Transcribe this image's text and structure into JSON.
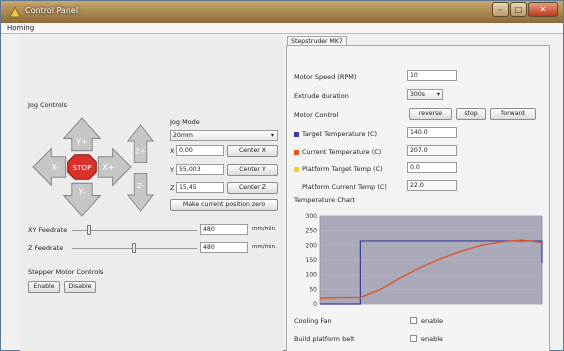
{
  "window": {
    "title": "Control Panel"
  },
  "menu": {
    "homing_tab": "Homing"
  },
  "jog": {
    "section_label": "Jog Controls",
    "y_plus": "Y+",
    "y_minus": "Y-",
    "x_plus": "X+",
    "x_minus": "X-",
    "z_plus": "Z+",
    "z_minus": "Z-",
    "stop": "STOP",
    "mode_label": "Jog Mode",
    "mode_value": "20mm",
    "x_label": "X",
    "x_value": "0,00",
    "y_label": "Y",
    "y_value": "55,003",
    "z_label": "Z",
    "z_value": "15,45",
    "center_x": "Center X",
    "center_y": "Center Y",
    "center_z": "Center Z",
    "make_zero": "Make current position zero"
  },
  "feedrate": {
    "xy_label": "XY Feedrate",
    "xy_value": "480",
    "xy_unit": "mm/min.",
    "z_label": "Z Feedrate",
    "z_value": "480",
    "z_unit": "mm/min."
  },
  "stepper": {
    "section_label": "Stepper Motor Controls",
    "enable": "Enable",
    "disable": "Disable"
  },
  "extruder": {
    "tab_label": "Stepstruder MK7",
    "motor_speed_label": "Motor Speed (RPM)",
    "motor_speed_value": "10",
    "extrude_duration_label": "Extrude duration",
    "extrude_duration_value": "300s",
    "motor_control_label": "Motor Control",
    "reverse": "reverse",
    "stop": "stop",
    "forward": "forward",
    "target_temp_label": "Target Temperature (C)",
    "target_temp_value": "140.0",
    "current_temp_label": "Current Temperature (C)",
    "current_temp_value": "207.0",
    "platform_target_label": "Platform Target Temp (C)",
    "platform_target_value": "0.0",
    "platform_current_label": "Platform Current Temp (C)",
    "platform_current_value": "22.0",
    "chart_label": "Temperature Chart",
    "cooling_fan_label": "Cooling Fan",
    "cooling_fan_check": "enable",
    "build_platform_label": "Build platform belt",
    "build_platform_check": "enable"
  },
  "colors": {
    "target_temp": "#3b3b9e",
    "current_temp": "#e0562a",
    "platform_target": "#f0d030"
  },
  "chart_data": {
    "type": "line",
    "y_ticks": [
      "300",
      "250",
      "200",
      "150",
      "100",
      "50",
      "0"
    ],
    "ylim": [
      0,
      300
    ],
    "series": [
      {
        "values": [
          0,
          0,
          215,
          215,
          215,
          215,
          215,
          215,
          215,
          215,
          215,
          140
        ]
      },
      {
        "values": [
          20,
          22,
          22,
          50,
          90,
          125,
          155,
          180,
          200,
          212,
          218,
          210
        ]
      }
    ]
  }
}
